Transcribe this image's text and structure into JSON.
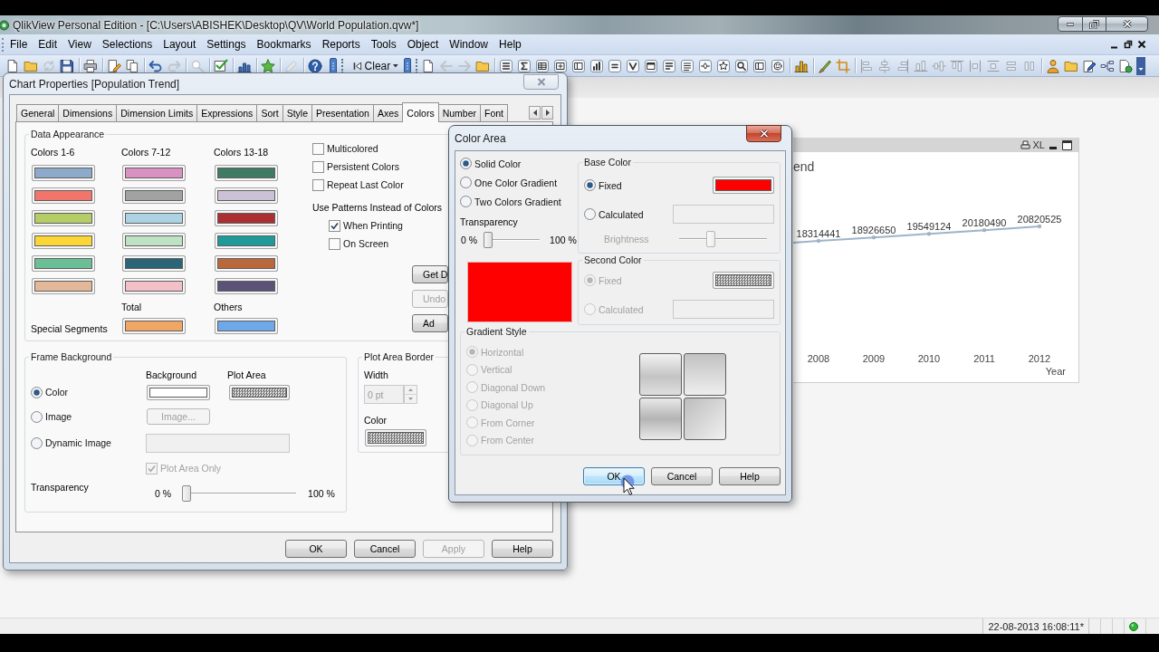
{
  "window": {
    "title": "QlikView Personal Edition - [C:\\Users\\ABISHEK\\Desktop\\QV\\World Population.qvw*]"
  },
  "menu": [
    "File",
    "Edit",
    "View",
    "Selections",
    "Layout",
    "Settings",
    "Bookmarks",
    "Reports",
    "Tools",
    "Object",
    "Window",
    "Help"
  ],
  "toolbar": {
    "clear_label": "Clear"
  },
  "chart_object": {
    "caption_label": "XL",
    "chart_data": {
      "type": "line",
      "title": "end",
      "xlabel": "Year",
      "categories": [
        "2008",
        "2009",
        "2010",
        "2011",
        "2012"
      ],
      "series": [
        {
          "color": "#9fb4c8",
          "values": [
            18314441,
            18926650,
            19549124,
            20180490,
            20820525
          ]
        }
      ],
      "data_labels": true
    }
  },
  "chart_properties": {
    "title": "Chart Properties [Population Trend]",
    "tabs": [
      {
        "label": "General",
        "selected": false
      },
      {
        "label": "Dimensions",
        "selected": false
      },
      {
        "label": "Dimension Limits",
        "selected": false
      },
      {
        "label": "Expressions",
        "selected": false
      },
      {
        "label": "Sort",
        "selected": false
      },
      {
        "label": "Style",
        "selected": false
      },
      {
        "label": "Presentation",
        "selected": false
      },
      {
        "label": "Axes",
        "selected": false
      },
      {
        "label": "Colors",
        "selected": true
      },
      {
        "label": "Number",
        "selected": false
      },
      {
        "label": "Font",
        "selected": false
      }
    ],
    "data_appearance": {
      "title": "Data Appearance",
      "palettes": [
        {
          "label": "Colors 1-6",
          "swatches": [
            {
              "color": "#8eaacb"
            },
            {
              "color": "#f2756b"
            },
            {
              "color": "#b5cd66"
            },
            {
              "color": "#fbd634"
            },
            {
              "color": "#6bbf96"
            },
            {
              "color": "#e2b898"
            }
          ]
        },
        {
          "label": "Colors 7-12",
          "swatches": [
            {
              "color": "#d891c1"
            },
            {
              "color": "#a2a2a2"
            },
            {
              "color": "#acd3e3"
            },
            {
              "color": "#bde2c4"
            },
            {
              "color": "#2b6577"
            },
            {
              "color": "#f4c0c8"
            }
          ]
        },
        {
          "label": "Colors 13-18",
          "swatches": [
            {
              "color": "#3f7a62"
            },
            {
              "color": "#cbc2d8"
            },
            {
              "color": "#ab2f31"
            },
            {
              "color": "#1f9a9a"
            },
            {
              "color": "#b9673b"
            },
            {
              "color": "#5a5277"
            }
          ]
        }
      ],
      "special_segments": {
        "label": "Special Segments",
        "items": [
          {
            "label": "Total",
            "color": "#f0a664"
          },
          {
            "label": "Others",
            "color": "#6fa8e8"
          }
        ]
      },
      "options": [
        {
          "label": "Multicolored",
          "checked": false
        },
        {
          "label": "Persistent Colors",
          "checked": false
        },
        {
          "label": "Repeat Last Color",
          "checked": false
        }
      ],
      "patterns": {
        "label": "Use Patterns Instead of Colors",
        "options": [
          {
            "label": "When Printing",
            "checked": true
          },
          {
            "label": "On Screen",
            "checked": false
          }
        ]
      },
      "buttons": [
        {
          "label": "Get D",
          "disabled": false
        },
        {
          "label": "Undo",
          "disabled": true
        },
        {
          "label": "Ad",
          "disabled": false
        }
      ]
    },
    "frame_background": {
      "title": "Frame Background",
      "column_labels": [
        "Background",
        "Plot Area"
      ],
      "modes": [
        {
          "label": "Color",
          "selected": true
        },
        {
          "label": "Image",
          "selected": false
        },
        {
          "label": "Dynamic Image",
          "selected": false
        }
      ],
      "swatches": [
        {
          "kind": "solid",
          "color": "#ffffff"
        },
        {
          "kind": "pattern"
        }
      ],
      "image_button": {
        "label": "Image...",
        "disabled": true
      },
      "dynamic_image_field": {
        "disabled": true
      },
      "plot_area_only": {
        "label": "Plot Area Only",
        "checked": true,
        "disabled": true
      },
      "transparency": {
        "label": "Transparency",
        "min_label": "0 %",
        "max_label": "100 %",
        "level": 0
      }
    },
    "plot_area_border": {
      "title": "Plot Area Border",
      "width_label": "Width",
      "width_value": "0 pt",
      "width_disabled": true,
      "color_label": "Color",
      "swatch": {
        "kind": "pattern"
      }
    },
    "buttons": [
      {
        "label": "OK",
        "disabled": false
      },
      {
        "label": "Cancel",
        "disabled": false
      },
      {
        "label": "Apply",
        "disabled": true
      },
      {
        "label": "Help",
        "disabled": false
      }
    ]
  },
  "color_area": {
    "title": "Color Area",
    "fill_modes": [
      {
        "label": "Solid Color",
        "selected": true
      },
      {
        "label": "One Color Gradient",
        "selected": false
      },
      {
        "label": "Two Colors Gradient",
        "selected": false
      }
    ],
    "transparency": {
      "label": "Transparency",
      "min_label": "0 %",
      "max_label": "100 %",
      "level": 0
    },
    "preview": {
      "color": "#ff0000"
    },
    "base_color": {
      "title": "Base Color",
      "options": [
        {
          "label": "Fixed",
          "selected": true
        },
        {
          "label": "Calculated",
          "selected": false
        }
      ],
      "color": "#ff0000",
      "brightness": {
        "label": "Brightness",
        "disabled": true,
        "level": 0.35
      }
    },
    "second_color": {
      "title": "Second Color",
      "disabled": true,
      "options": [
        {
          "label": "Fixed",
          "selected": true
        },
        {
          "label": "Calculated",
          "selected": false
        }
      ],
      "swatch": {
        "kind": "pattern"
      }
    },
    "gradient_style": {
      "title": "Gradient Style",
      "disabled": true,
      "options": [
        {
          "label": "Horizontal",
          "selected": true
        },
        {
          "label": "Vertical",
          "selected": false
        },
        {
          "label": "Diagonal Down",
          "selected": false
        },
        {
          "label": "Diagonal Up",
          "selected": false
        },
        {
          "label": "From Corner",
          "selected": false
        },
        {
          "label": "From Center",
          "selected": false
        }
      ]
    },
    "buttons": [
      {
        "label": "OK",
        "focused": true
      },
      {
        "label": "Cancel",
        "focused": false
      },
      {
        "label": "Help",
        "focused": false
      }
    ]
  },
  "status_bar": {
    "timestamp": "22-08-2013 16:08:11*"
  }
}
